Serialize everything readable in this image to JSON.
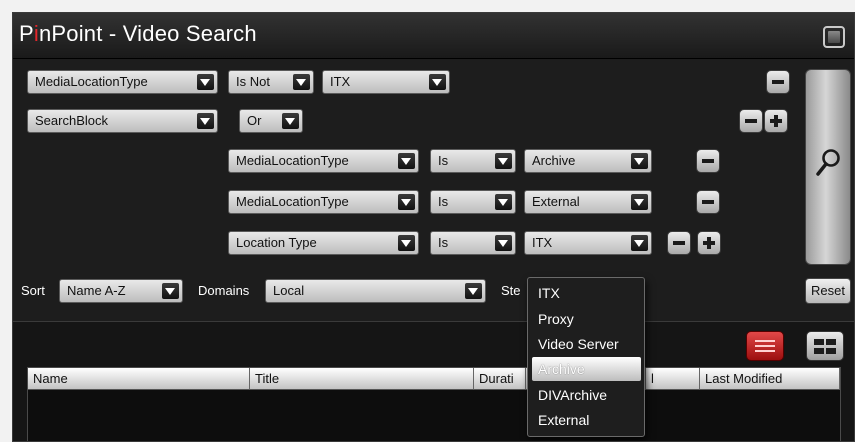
{
  "window": {
    "title_pre": "P",
    "title_accent": "i",
    "title_post": "nPoint - Video Search",
    "accent_color": "#e3262b"
  },
  "filters": {
    "row1": {
      "field": "MediaLocationType",
      "operator": "Is Not",
      "value": "ITX"
    },
    "row2": {
      "field": "SearchBlock",
      "operator": "Or"
    },
    "row3": {
      "field": "MediaLocationType",
      "operator": "Is",
      "value": "Archive"
    },
    "row4": {
      "field": "MediaLocationType",
      "operator": "Is",
      "value": "External"
    },
    "row5": {
      "field": "Location Type",
      "operator": "Is",
      "value": "ITX"
    }
  },
  "options_bar": {
    "sort_label": "Sort",
    "sort_value": "Name A-Z",
    "domains_label": "Domains",
    "domains_value": "Local",
    "partial_label": "Ste",
    "reset_label": "Reset"
  },
  "icons": {
    "search": "magnifier-icon",
    "list_view": "list-view-icon",
    "grid_view": "grid-view-icon",
    "maximize": "maximize-icon"
  },
  "table": {
    "columns": [
      "Name",
      "Title",
      "Durati",
      "",
      "l",
      "Last Modified"
    ]
  },
  "dropdown_menu": {
    "items": [
      "ITX",
      "Proxy",
      "Video Server",
      "Archive",
      "DIVArchive",
      "External"
    ],
    "highlighted": "Archive"
  }
}
